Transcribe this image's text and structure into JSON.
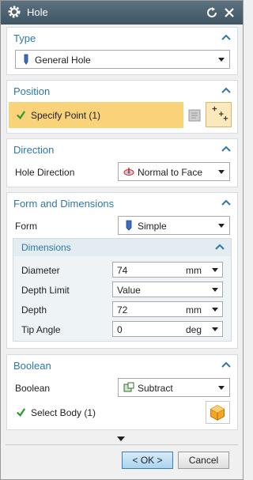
{
  "window": {
    "title": "Hole"
  },
  "type": {
    "header": "Type",
    "value": "General Hole"
  },
  "position": {
    "header": "Position",
    "specify_point": "Specify Point (1)"
  },
  "direction": {
    "header": "Direction",
    "label": "Hole Direction",
    "value": "Normal to Face"
  },
  "form": {
    "header": "Form and Dimensions",
    "form_label": "Form",
    "form_value": "Simple",
    "dimensions": {
      "header": "Dimensions",
      "diameter": {
        "label": "Diameter",
        "value": "74",
        "unit": "mm"
      },
      "depth_limit": {
        "label": "Depth Limit",
        "value": "Value"
      },
      "depth": {
        "label": "Depth",
        "value": "72",
        "unit": "mm"
      },
      "tip_angle": {
        "label": "Tip Angle",
        "value": "0",
        "unit": "deg"
      }
    }
  },
  "boolean": {
    "header": "Boolean",
    "label": "Boolean",
    "value": "Subtract",
    "select_body": "Select Body (1)"
  },
  "footer": {
    "ok": "< OK >",
    "cancel": "Cancel"
  },
  "colors": {
    "accent": "#2e78a8",
    "highlight": "#f9d27a",
    "check": "#2a9d2a",
    "title_bar": "#4a5f6e"
  },
  "icons": [
    "gear-icon",
    "reset-icon",
    "close-icon",
    "collapse-icon",
    "general-hole-icon",
    "checkmark-icon",
    "point-dialog-icon",
    "point-icon",
    "normal-to-face-icon",
    "simple-form-icon",
    "subtract-icon",
    "solid-body-icon",
    "expand-more-icon"
  ]
}
